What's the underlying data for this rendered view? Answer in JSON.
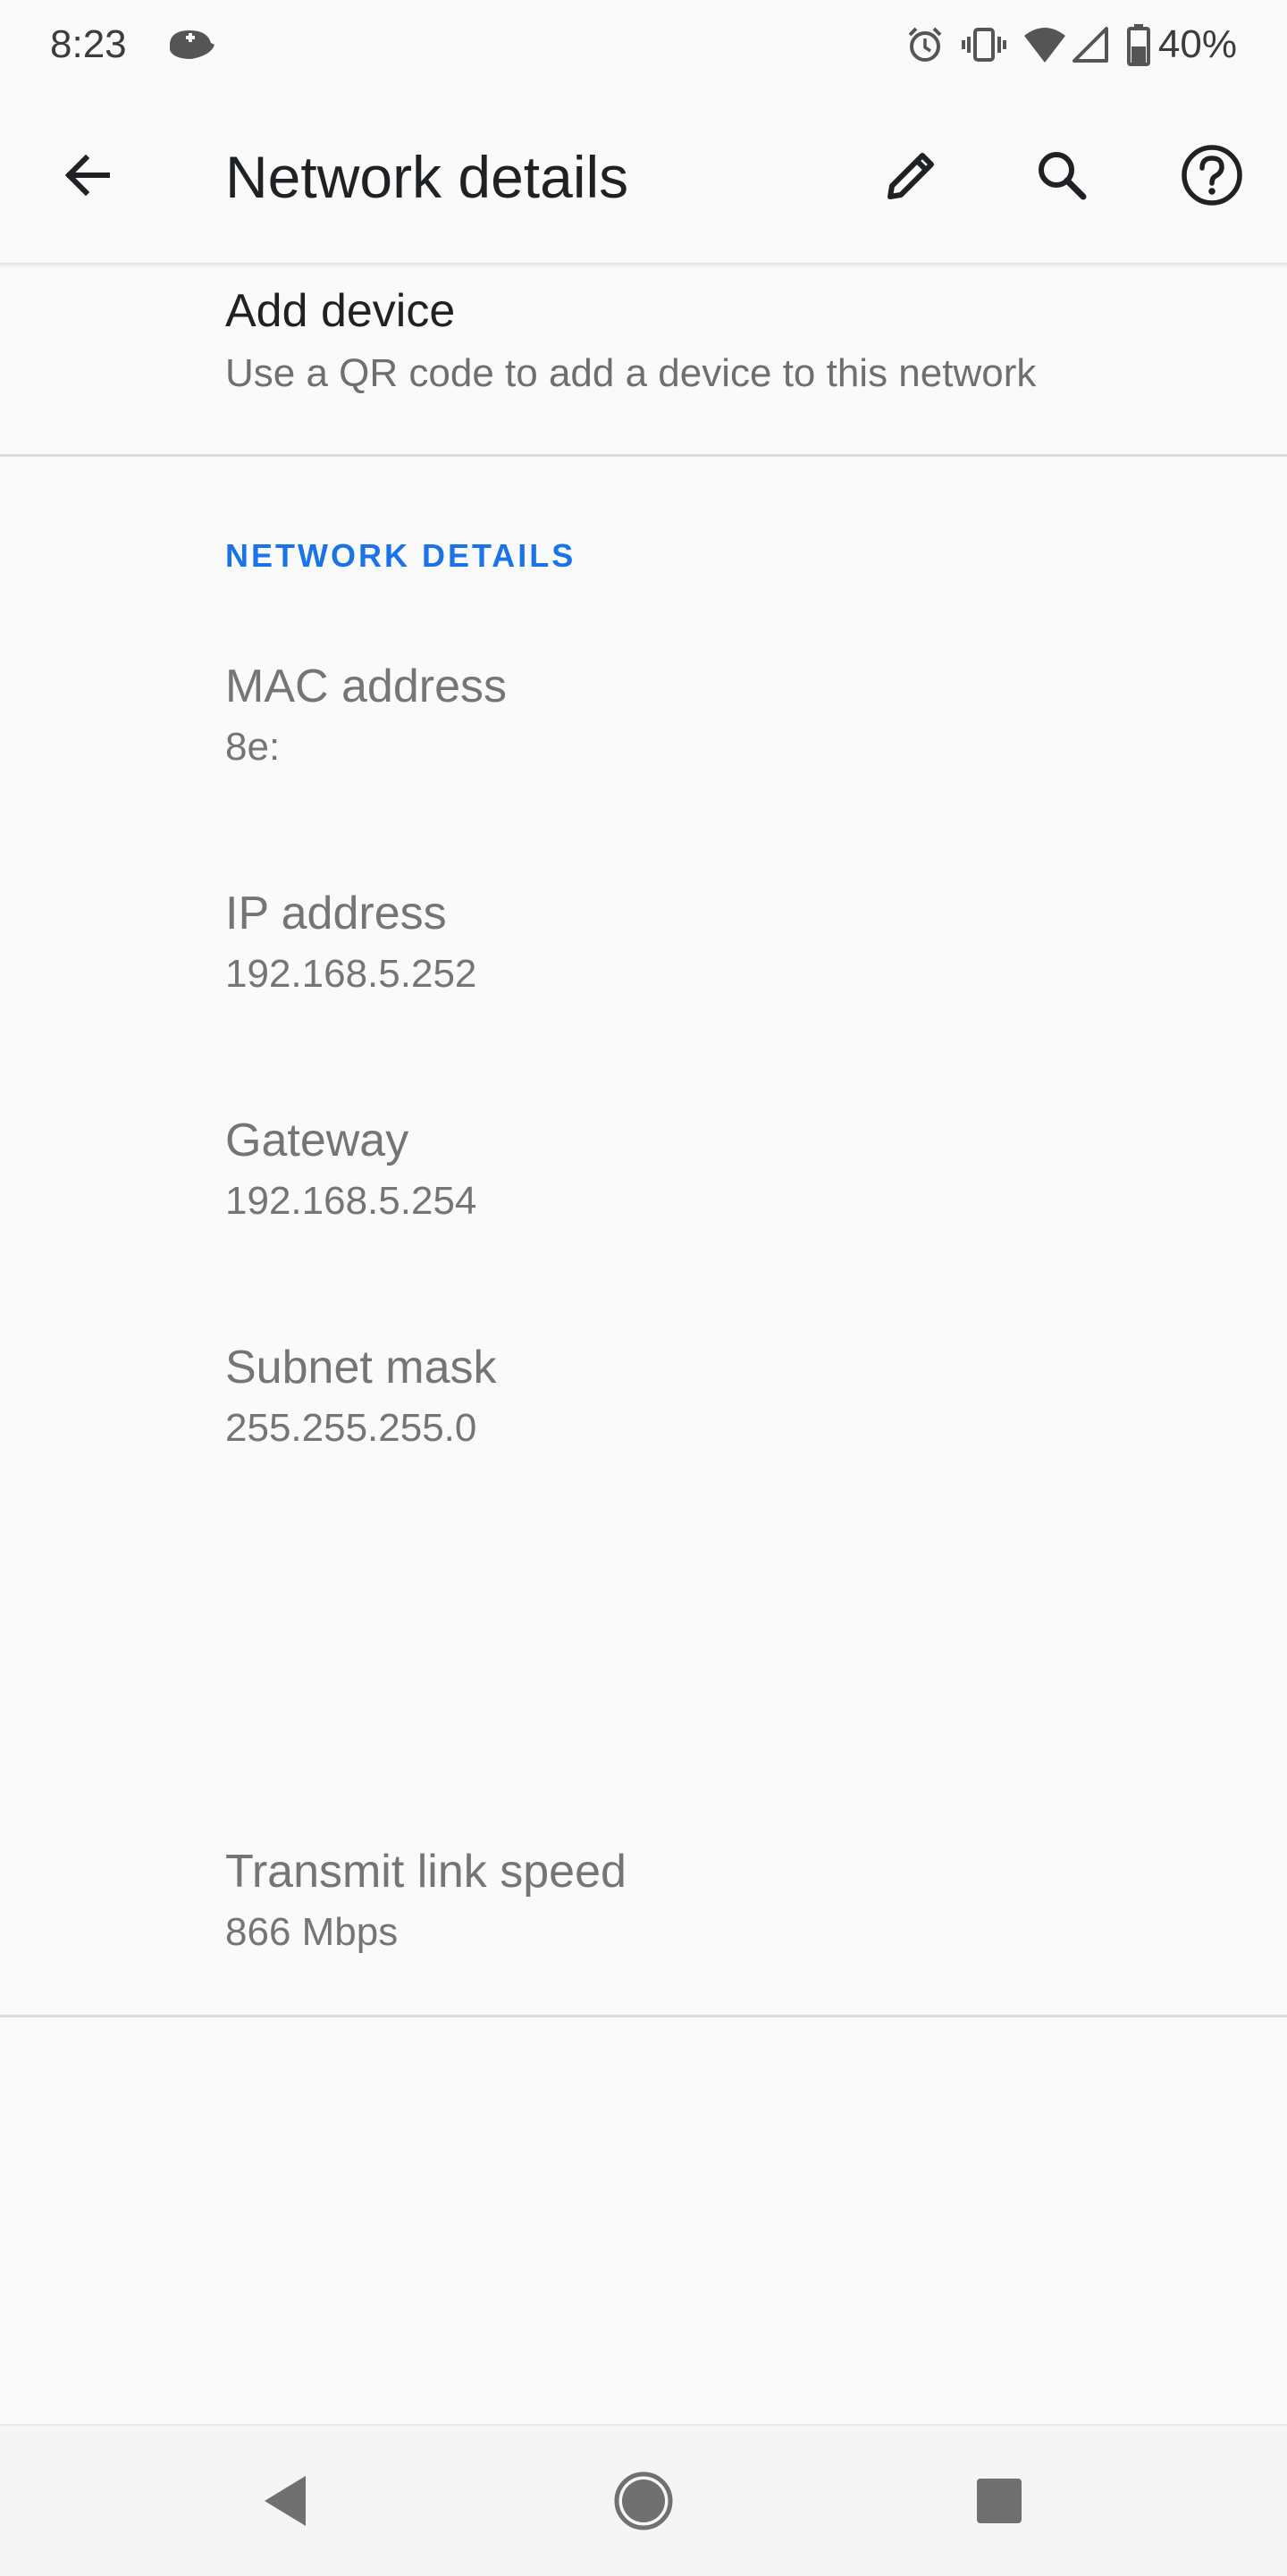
{
  "status_bar": {
    "time": "8:23",
    "battery_text": "40%",
    "icons": [
      "notification-icon",
      "alarm-icon",
      "vibrate-icon",
      "wifi-icon",
      "cell-signal-icon",
      "battery-icon"
    ]
  },
  "app_bar": {
    "title": "Network details",
    "actions": [
      "back-icon",
      "edit-icon",
      "search-icon",
      "help-icon"
    ]
  },
  "add_device": {
    "title": "Add device",
    "subtitle": "Use a QR code to add a device to this network"
  },
  "section": {
    "header": "NETWORK DETAILS",
    "accent_color": "#1a73e8"
  },
  "details": {
    "mac": {
      "label": "MAC address",
      "value": "8e:"
    },
    "ip": {
      "label": "IP address",
      "value": "192.168.5.252"
    },
    "gateway": {
      "label": "Gateway",
      "value": "192.168.5.254"
    },
    "subnet": {
      "label": "Subnet mask",
      "value": "255.255.255.0"
    },
    "speed": {
      "label": "Transmit link speed",
      "value": "866 Mbps"
    }
  },
  "nav_bar": {
    "buttons": [
      "nav-back-icon",
      "nav-home-icon",
      "nav-recents-icon"
    ]
  }
}
